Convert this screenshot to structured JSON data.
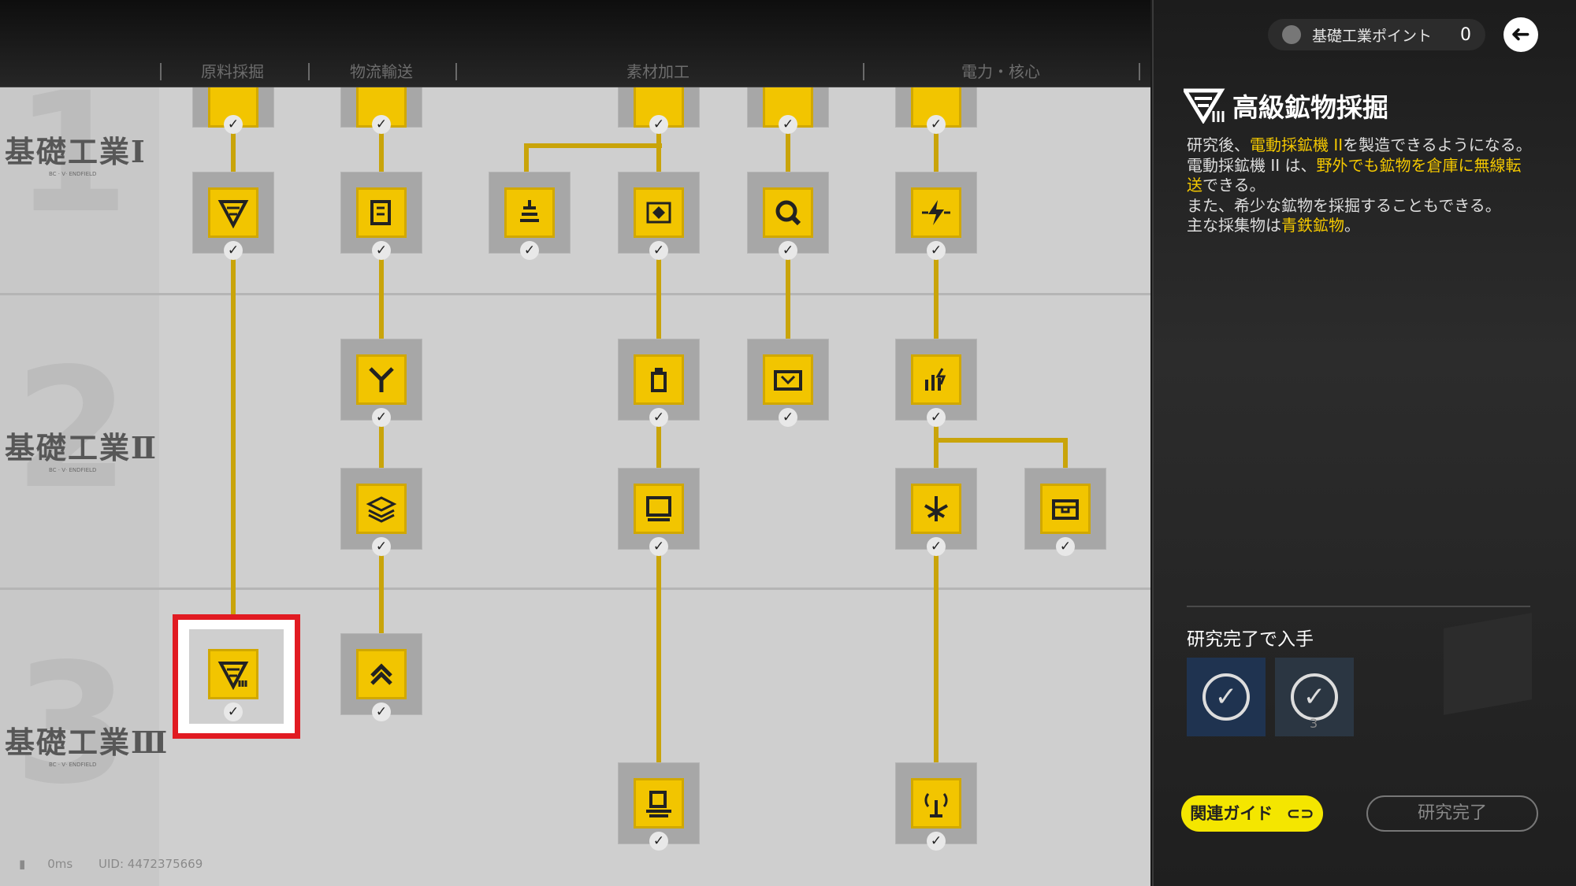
{
  "columns": [
    "原料採掘",
    "物流輸送",
    "素材加工",
    "電力・核心"
  ],
  "tiers": [
    {
      "label": "基礎工業Ⅰ",
      "sub": "BC · V· ENDFIELD",
      "num": "1"
    },
    {
      "label": "基礎工業Ⅱ",
      "sub": "BC · V· ENDFIELD",
      "num": "2"
    },
    {
      "label": "基礎工業Ⅲ",
      "sub": "BC · V· ENDFIELD",
      "num": "3"
    }
  ],
  "check_mark": "✓",
  "nodes": [
    {
      "name": "node-mining-base-icon",
      "icon": "mining-drill-icon",
      "cut": true
    },
    {
      "name": "node-logistics-base-icon",
      "icon": "storage-icon",
      "cut": true
    },
    {
      "name": "node-material-base-icon",
      "icon": "refinery-icon",
      "cut": true
    },
    {
      "name": "node-material-base2-icon",
      "icon": "grid-icon",
      "cut": true
    },
    {
      "name": "node-power-base-icon",
      "icon": "power-icon",
      "cut": true
    },
    {
      "name": "node-mining-drill-ii-icon",
      "icon": "mining-drill-ii-icon"
    },
    {
      "name": "node-logistics-storage-icon",
      "icon": "storage-icon"
    },
    {
      "name": "node-material-smelter-icon",
      "icon": "furnace-icon"
    },
    {
      "name": "node-material-processor-icon",
      "icon": "gear-icon"
    },
    {
      "name": "node-material-grinder-icon",
      "icon": "wrench-icon"
    },
    {
      "name": "node-power-relay-icon",
      "icon": "lightning-icon"
    },
    {
      "name": "node-logistics-splitter-icon",
      "icon": "splitter-icon"
    },
    {
      "name": "node-material-filler-icon",
      "icon": "bottle-icon"
    },
    {
      "name": "node-material-shaper-icon",
      "icon": "press-icon"
    },
    {
      "name": "node-power-generator-icon",
      "icon": "generator-icon"
    },
    {
      "name": "node-logistics-belt-icon",
      "icon": "layers-icon"
    },
    {
      "name": "node-material-packer-icon",
      "icon": "monitor-icon"
    },
    {
      "name": "node-power-pylon-icon",
      "icon": "pylon-icon"
    },
    {
      "name": "node-power-box-icon",
      "icon": "box-icon"
    },
    {
      "name": "node-mining-drill-iii-icon",
      "icon": "mining-drill-iii-icon"
    },
    {
      "name": "node-logistics-bridge-icon",
      "icon": "chevrons-up-icon"
    },
    {
      "name": "node-material-assembler-icon",
      "icon": "machine-icon"
    },
    {
      "name": "node-power-core-icon",
      "icon": "signal-icon"
    }
  ],
  "footer": {
    "ping": "0ms",
    "uid": "UID: 4472375669"
  },
  "panel": {
    "points_label": "基礎工業ポイント",
    "points_value": "0",
    "back_glyph": "➜",
    "title_icon": "mining-drill-iii-icon",
    "title": "高級鉱物採掘",
    "desc": {
      "p1_a": "研究後、",
      "p1_hl": "電動採鉱機 II",
      "p1_b": "を製造できるようになる。",
      "p2_a": "電動採鉱機 II は、",
      "p2_hl": "野外でも鉱物を倉庫に無線転送",
      "p2_b": "できる。",
      "p3": "また、希少な鉱物を採掘することもできる。",
      "p4_a": "主な採集物は",
      "p4_hl": "青鉄鉱物",
      "p4_b": "。"
    },
    "rewards_title": "研究完了で入手",
    "reward_count": "3",
    "guide_button": "関連ガイド",
    "done_button": "研究完了"
  },
  "colors": {
    "accent": "#f2c500",
    "line": "#c9a40a",
    "highlight": "#f4c800",
    "selection": "#e11b22"
  }
}
